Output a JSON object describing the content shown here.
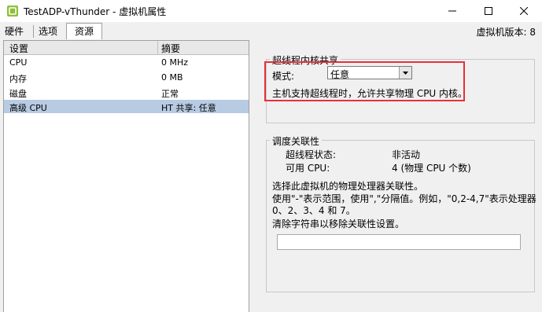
{
  "window": {
    "title": "TestADP-vThunder - 虚拟机属性"
  },
  "tabs": [
    {
      "label": "硬件"
    },
    {
      "label": "选项"
    },
    {
      "label": "资源"
    }
  ],
  "vm_version": "虚拟机版本: 8",
  "settings_list": {
    "headers": [
      "设置",
      "摘要"
    ],
    "rows": [
      {
        "setting": "CPU",
        "summary": "0 MHz"
      },
      {
        "setting": "内存",
        "summary": "0 MB"
      },
      {
        "setting": "磁盘",
        "summary": "正常"
      },
      {
        "setting": "高级 CPU",
        "summary": "HT 共享: 任意"
      }
    ]
  },
  "hyperthread_group": {
    "title": "超线程内核共享",
    "mode_label": "模式:",
    "mode_value": "任意",
    "description": "主机支持超线程时，允许共享物理 CPU 内核。"
  },
  "affinity_group": {
    "title": "调度关联性",
    "ht_status_label": "超线程状态:",
    "ht_status_value": "非活动",
    "available_cpu_label": "可用 CPU:",
    "available_cpu_value": "4 (物理 CPU 个数)",
    "instructions_1": "选择此虚拟机的物理处理器关联性。",
    "instructions_2": "使用\"-\"表示范围，使用\",\"分隔值。例如，\"0,2-4,7\"表示处理器",
    "instructions_3": "0、2、3、4 和 7。",
    "clear_hint": "清除字符串以移除关联性设置。",
    "affinity_value": ""
  },
  "colors": {
    "selected_row": "#b7cbe3",
    "highlight_box": "#e8303a"
  }
}
